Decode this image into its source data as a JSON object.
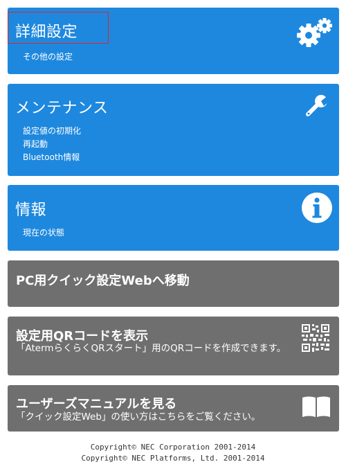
{
  "cards": {
    "advanced": {
      "title": "詳細設定",
      "items": [
        "その他の設定"
      ],
      "icon": "gears-icon"
    },
    "maintenance": {
      "title": "メンテナンス",
      "items": [
        "設定値の初期化",
        "再起動",
        "Bluetooth情報"
      ],
      "icon": "wrench-icon"
    },
    "info": {
      "title": "情報",
      "items": [
        "現在の状態"
      ],
      "icon": "info-icon"
    },
    "pc_quick": {
      "title": "PC用クイック設定Webへ移動"
    },
    "qr": {
      "title": "設定用QRコードを表示",
      "description": "「AtermらくらくQRスタート」用のQRコードを作成できます。",
      "icon": "qr-code-icon"
    },
    "manual": {
      "title": "ユーザーズマニュアルを見る",
      "description": "「クイック設定Web」の使い方はこちらをご覧ください。",
      "icon": "book-icon"
    }
  },
  "footer": {
    "line1": "Copyright© NEC Corporation 2001-2014",
    "line2": "Copyright© NEC Platforms, Ltd. 2001-2014"
  },
  "colors": {
    "blue_card": "#1e88de",
    "gray_card": "#6f6f6f",
    "highlight": "#e0252b"
  }
}
